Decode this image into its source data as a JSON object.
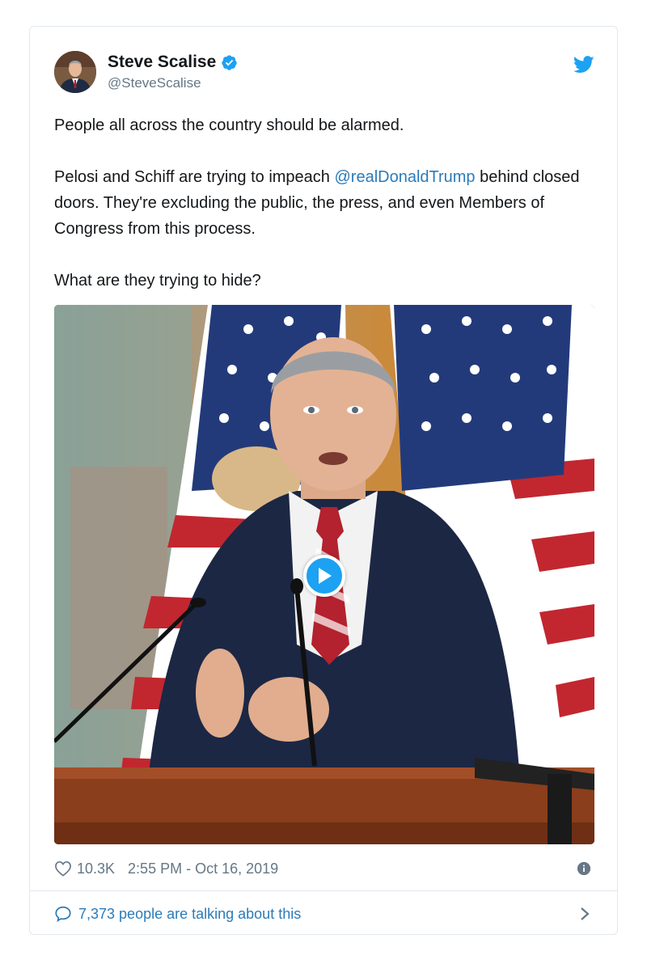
{
  "tweet": {
    "display_name": "Steve Scalise",
    "handle": "@SteveScalise",
    "verified": true,
    "paragraph1": "People all across the country should be alarmed.",
    "paragraph2_pre": "Pelosi and Schiff are trying to impeach ",
    "mention": "@realDonaldTrump",
    "paragraph2_post": " behind closed doors. They're excluding the public, the press, and even Members of Congress from this process.",
    "paragraph3": "What are they trying to hide?",
    "likes": "10.3K",
    "timestamp": "2:55 PM - Oct 16, 2019",
    "talking": "7,373 people are talking about this"
  },
  "icons": {
    "verified": "verified-badge-icon",
    "brand": "twitter-bird-icon",
    "play": "play-icon",
    "like": "heart-icon",
    "info": "info-icon",
    "reply": "speech-bubble-icon",
    "chevron": "chevron-right-icon"
  },
  "colors": {
    "twitter_blue": "#1da1f2",
    "link": "#2b7bb9",
    "secondary_text": "#657786",
    "border": "#e1e8ed"
  }
}
